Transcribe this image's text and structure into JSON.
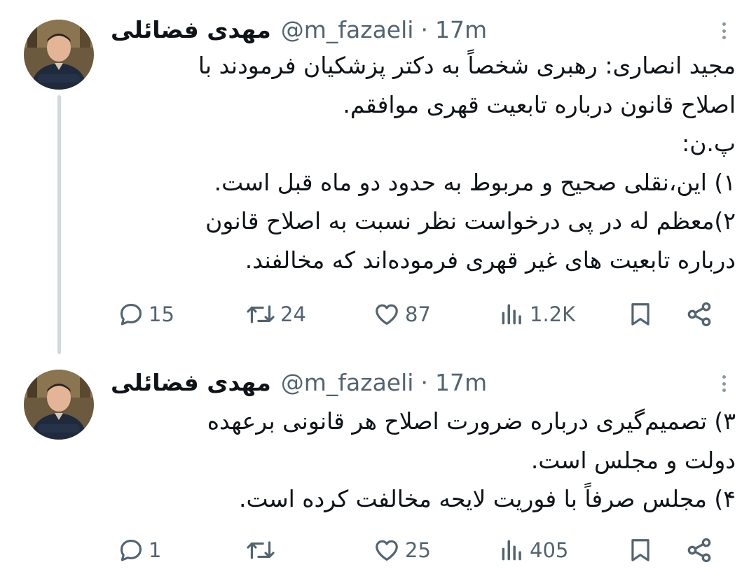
{
  "tweets": [
    {
      "display_name": "مهدی فضائلی",
      "handle": "@m_fazaeli",
      "separator": "·",
      "time": "17m",
      "lines": [
        "مجید انصاری: رهبری شخصاً به دکتر پزشکیان فرمودند با",
        "اصلاح قانون درباره تابعیت قهری موافقم.",
        "پ.ن:",
        "۱) این،نقلی صحیح و مربوط به حدود دو ماه قبل است.",
        "۲)معظم له در پی درخواست نظر نسبت به اصلاح قانون",
        "درباره تابعیت های غیر قهری فرموده‌اند که مخالفند."
      ],
      "stats": {
        "replies": "15",
        "retweets": "24",
        "likes": "87",
        "views": "1.2K"
      }
    },
    {
      "display_name": "مهدی فضائلی",
      "handle": "@m_fazaeli",
      "separator": "·",
      "time": "17m",
      "lines": [
        "۳) تصمیم‌گیری درباره ضرورت اصلاح هر قانونی برعهده",
        "دولت و مجلس است.",
        "۴) مجلس صرفاً با فوریت لایحه مخالفت کرده است."
      ],
      "stats": {
        "replies": "1",
        "retweets": "",
        "likes": "25",
        "views": "405"
      }
    }
  ],
  "colors": {
    "text": "#0f1419",
    "secondary": "#536471",
    "thread_line": "#cfd9de"
  },
  "icons": [
    "reply-icon",
    "retweet-icon",
    "like-icon",
    "views-icon",
    "bookmark-icon",
    "share-icon",
    "more-icon"
  ]
}
